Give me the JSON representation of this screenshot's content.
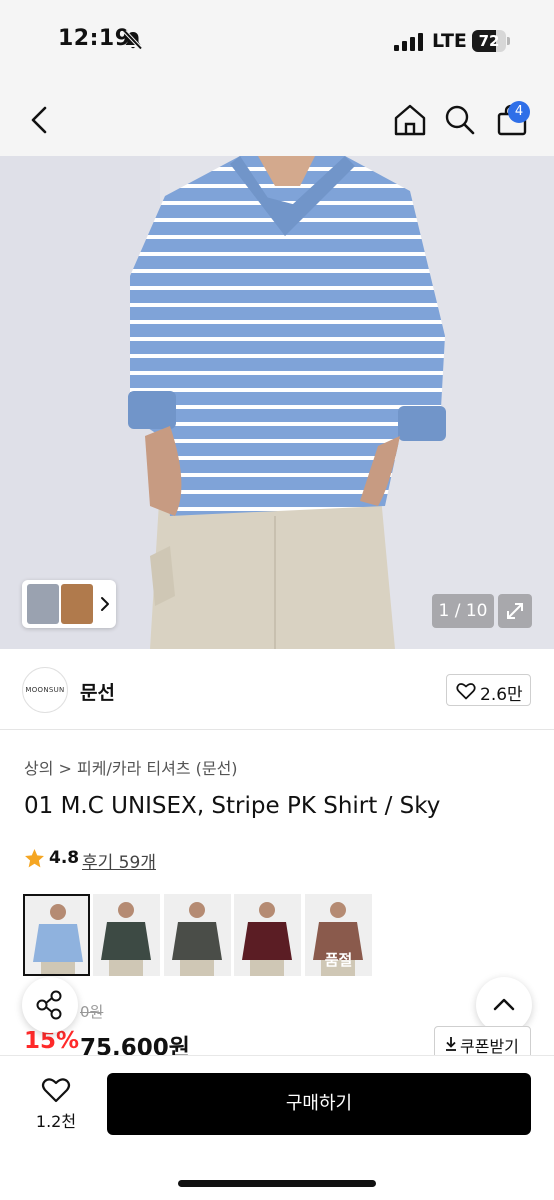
{
  "status_bar": {
    "time": "12:19",
    "network": "LTE",
    "battery_level": "72",
    "battery_fraction": 0.72
  },
  "nav": {
    "back_icon": "chevron-left-icon",
    "home_icon": "home-icon",
    "search_icon": "search-icon",
    "cart_icon": "bag-icon",
    "cart_count": "4"
  },
  "gallery": {
    "counter": "1 / 10",
    "expand_icon": "expand-icon",
    "thumb_arrow_icon": "chevron-right-icon"
  },
  "brand": {
    "logo_text": "MOONSUN",
    "name": "문선",
    "like_count": "2.6만"
  },
  "product": {
    "breadcrumb": "상의 > 피케/카라 티셔츠 (문선)",
    "title": "01 M.C UNISEX, Stripe PK Shirt / Sky",
    "rating": "4.8",
    "reviews": "후기 59개"
  },
  "variants": [
    {
      "color": "#8fb2de",
      "label": ""
    },
    {
      "color": "#3d4a44",
      "label": ""
    },
    {
      "color": "#4a4d48",
      "label": ""
    },
    {
      "color": "#5b1d24",
      "label": ""
    },
    {
      "color": "#8a5a4c",
      "label": "품절"
    }
  ],
  "price": {
    "original_partial": "0원",
    "discount": "15%",
    "sale": "75,600원",
    "coupon_label": "쿠폰받기"
  },
  "bottom": {
    "wish_count": "1.2천",
    "buy_label": "구매하기"
  },
  "colors": {
    "accent_red": "#ff2a2a",
    "badge_blue": "#2f6fe8",
    "star": "#f5a623"
  }
}
